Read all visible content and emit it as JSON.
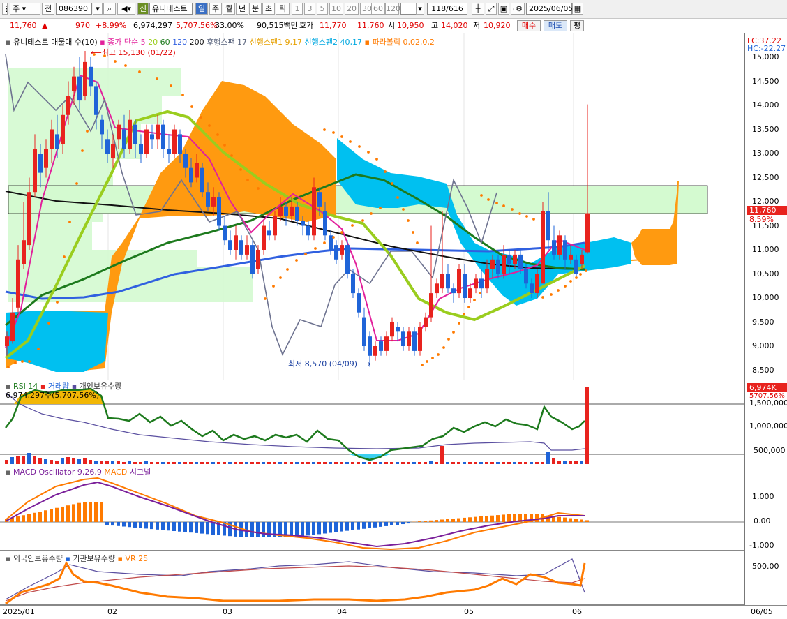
{
  "toolbar": {
    "period_tab": "주",
    "prev_button": "전",
    "code": "086390",
    "credit_badge": "신",
    "stock_name": "유니테스트",
    "timeframes": [
      "일",
      "주",
      "월",
      "년",
      "분",
      "초",
      "틱"
    ],
    "intervals": [
      "1",
      "3",
      "5",
      "10",
      "20",
      "30",
      "60",
      "120"
    ],
    "page_counter": "118/616",
    "date": "2025/06/05"
  },
  "quote": {
    "price": "11,760",
    "change_arrow": "▲",
    "change": "970",
    "change_pct": "+8.99%",
    "volume": "6,974,297",
    "volume_pct": "5,707.56%",
    "turnover": "33.00%",
    "amount": "90,515백만",
    "bid_label": "호가",
    "bid1": "11,770",
    "bid2": "11,760",
    "open_label": "시",
    "open": "10,950",
    "high_label": "고",
    "high": "14,020",
    "low_label": "저",
    "low": "10,920",
    "buy_button": "매수",
    "sell_button": "매도",
    "avg_button": "평"
  },
  "price_panel": {
    "legend": {
      "title": "유니테스트 매물대 수(10)",
      "sma": "종가 단순 5",
      "ma20": "20",
      "ma60": "60",
      "ma120": "120",
      "ma200": "200",
      "lagging": "후행스팬 17",
      "lead1": "선행스팬1 9,17",
      "lead2": "선행스팬2 40,17",
      "parabolic": "파라볼릭 0,02,0,2"
    },
    "high_note": "최고 15,130 (01/22)",
    "low_note": "최저 8,570 (04/09)",
    "lc": "LC:37.22",
    "hc": "HC:-22.27",
    "current_price": "11,760",
    "current_pct": "8.59%",
    "y_ticks": [
      "15,000",
      "14,500",
      "14,000",
      "13,500",
      "13,000",
      "12,500",
      "12,000",
      "11,500",
      "11,000",
      "10,500",
      "10,000",
      "9,500",
      "9,000",
      "8,500"
    ]
  },
  "volume_panel": {
    "legend": {
      "rsi": "RSI 14",
      "volume": "거래량",
      "individual": "개인보유수량"
    },
    "value_note": "6,974,297주(5,707.56%)",
    "current_volume": "6,974K",
    "current_pct": "5707.56%",
    "y_ticks": [
      "1,500,000",
      "1,000,000",
      "500,000"
    ]
  },
  "macd_panel": {
    "legend": {
      "osc": "MACD Oscillator 9,26,9",
      "macd": "MACD",
      "signal": "시그널"
    },
    "y_ticks": [
      "1,000",
      "0.00",
      "-1,000"
    ]
  },
  "bottom_panel": {
    "legend": {
      "foreign": "외국인보유수량",
      "institution": "기관보유수량",
      "vr": "VR 25"
    },
    "y_ticks": [
      "500.00"
    ]
  },
  "x_axis": {
    "labels": [
      "2025/01",
      "02",
      "03",
      "04",
      "05",
      "06"
    ],
    "right_label": "06/05"
  },
  "colors": {
    "up": "#e8231e",
    "down": "#1f64d8",
    "cloud_orange": "#ff9a10",
    "cloud_blue": "#00c0f0",
    "ma5": "#e2209b",
    "ma20": "#9acd1e",
    "ma60": "#1d7a1d",
    "ma120": "#3060e0",
    "ma200": "#111111"
  }
}
